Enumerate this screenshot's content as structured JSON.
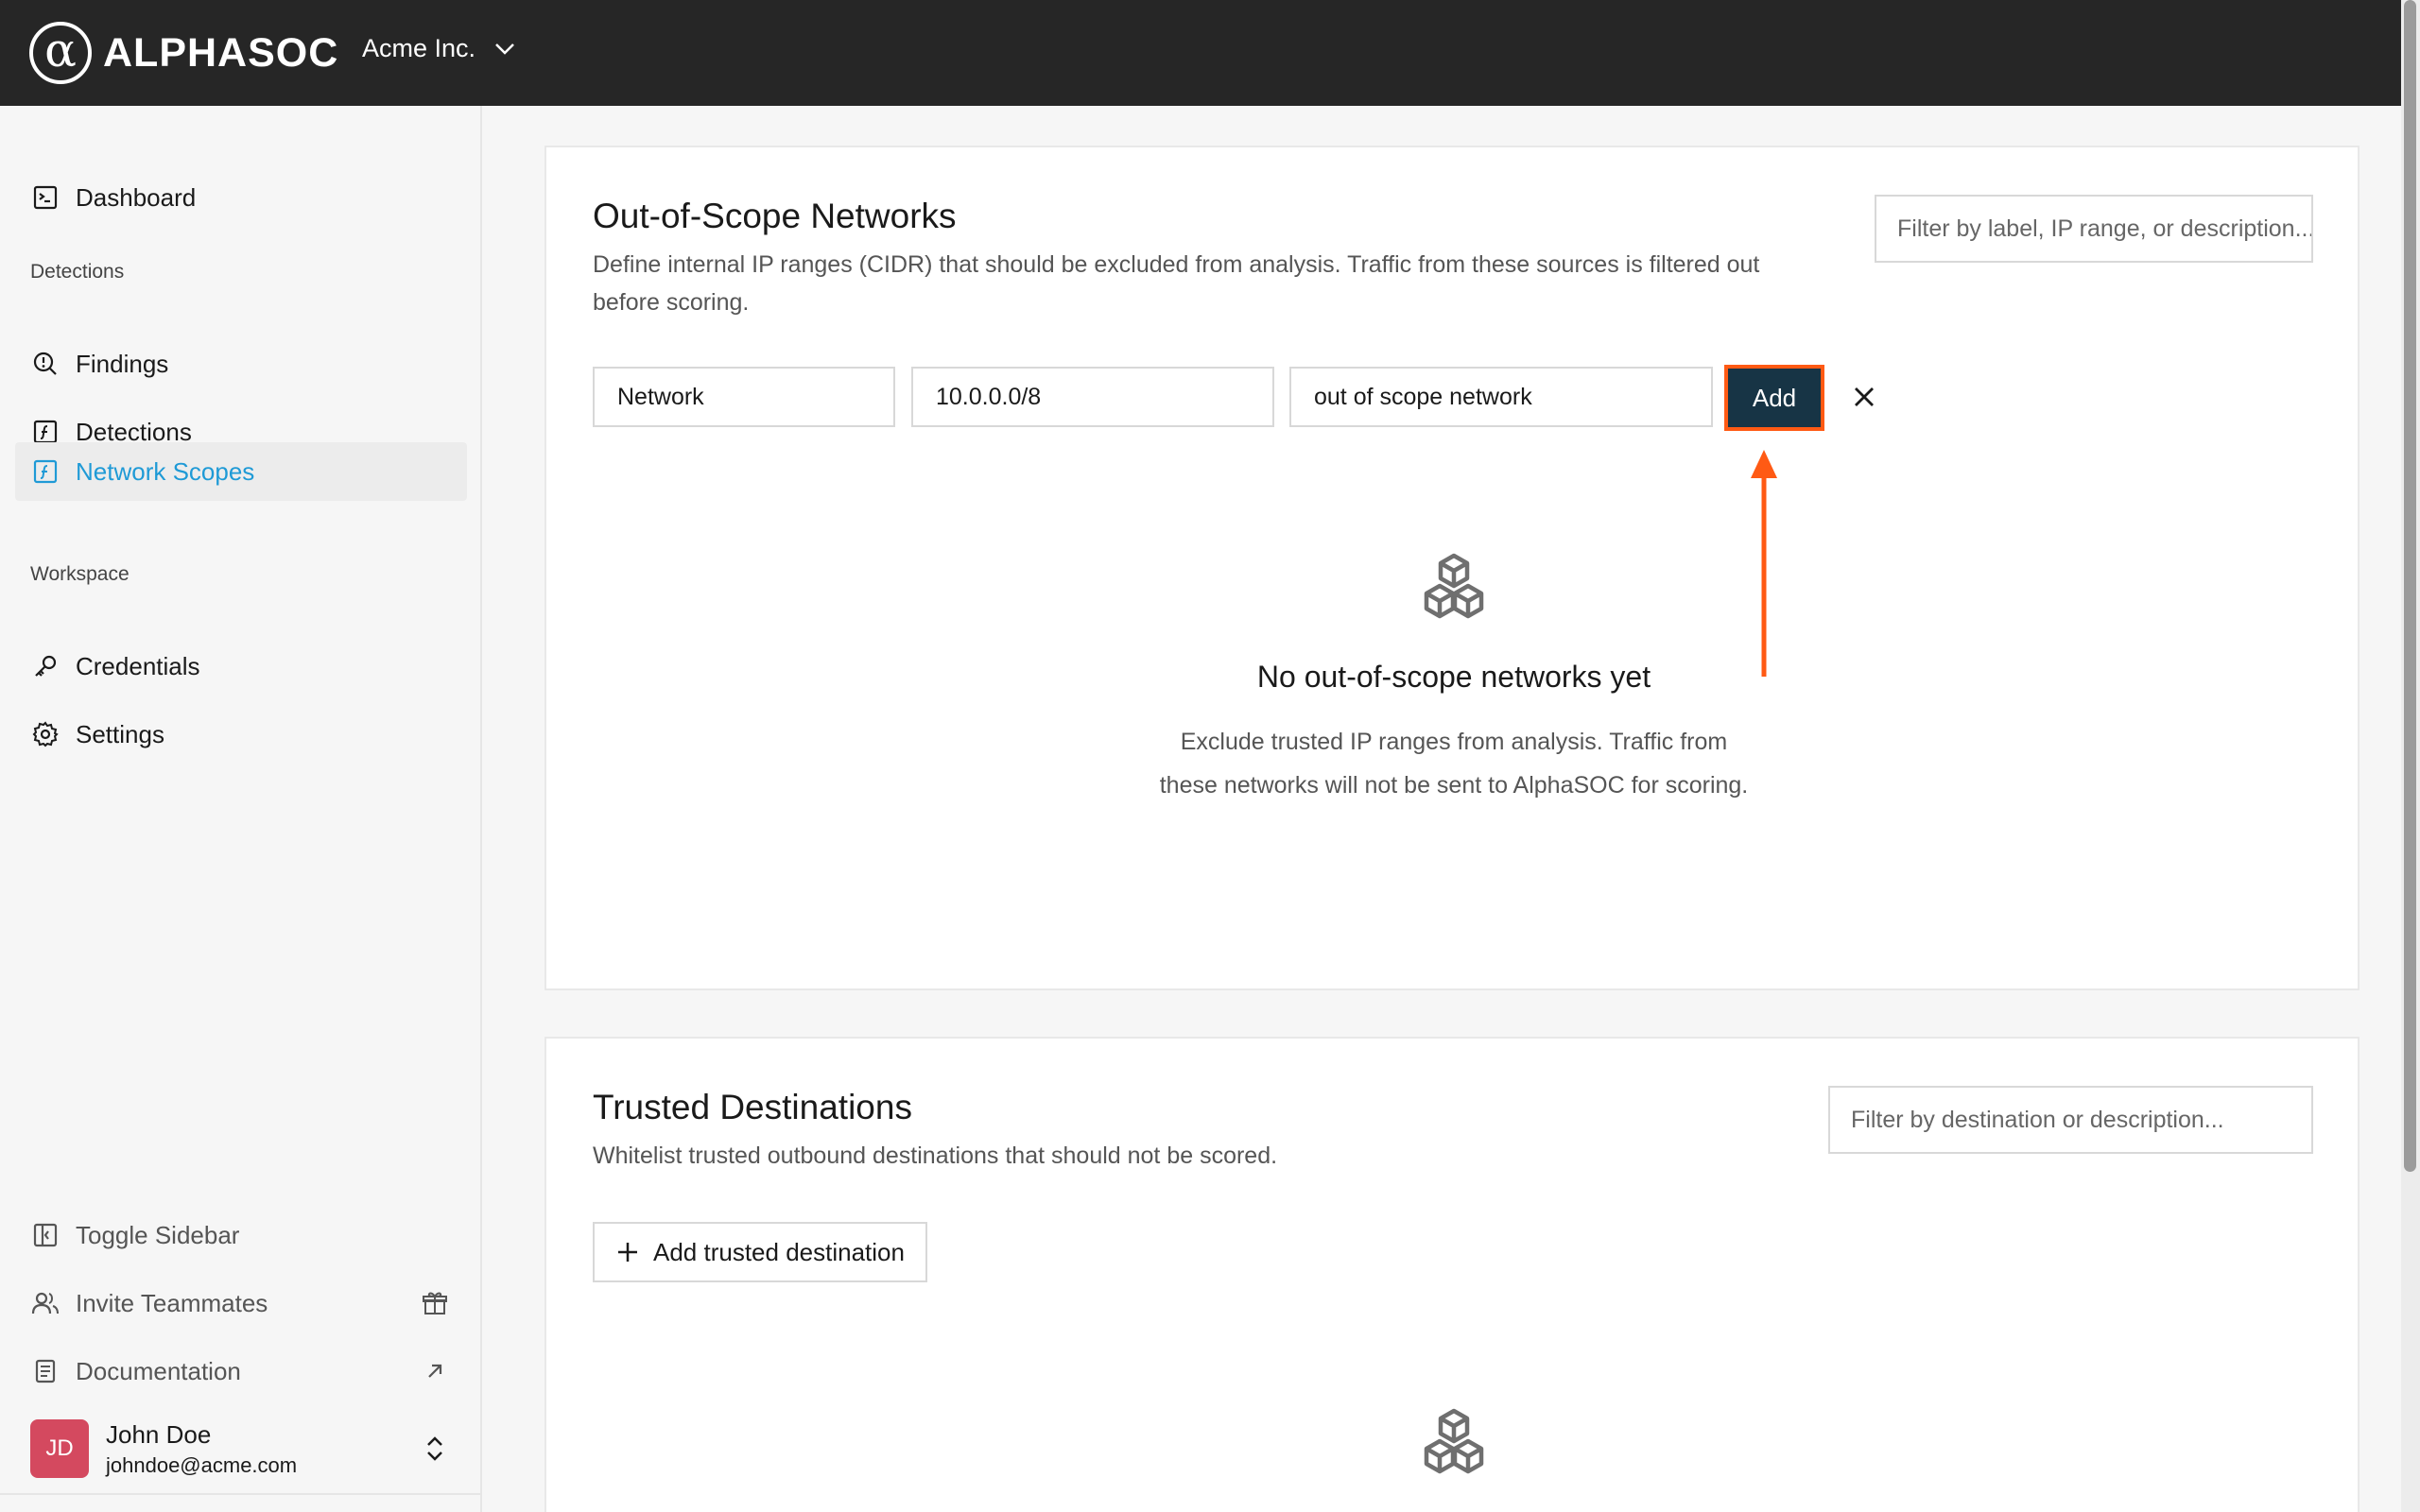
{
  "topbar": {
    "logo_mark": "α",
    "logo_text": "ALPHASOC",
    "org_name": "Acme Inc."
  },
  "sidebar": {
    "dashboard": "Dashboard",
    "section_detections": "Detections",
    "findings": "Findings",
    "detections": "Detections",
    "network_scopes": "Network Scopes",
    "section_workspace": "Workspace",
    "credentials": "Credentials",
    "settings": "Settings",
    "toggle_sidebar": "Toggle Sidebar",
    "invite_teammates": "Invite Teammates",
    "documentation": "Documentation"
  },
  "user": {
    "initials": "JD",
    "name": "John Doe",
    "email": "johndoe@acme.com"
  },
  "out_of_scope": {
    "title": "Out-of-Scope Networks",
    "description_line1": "Define internal IP ranges (CIDR) that should be excluded from analysis. Traffic from these sources is filtered out",
    "description_line2": "before scoring.",
    "filter_placeholder": "Filter by label, IP range, or description...",
    "label_value": "Network",
    "cidr_value": "10.0.0.0/8",
    "description_value": "out of scope network",
    "add_label": "Add",
    "empty_title": "No out-of-scope networks yet",
    "empty_desc_line1": "Exclude trusted IP ranges from analysis. Traffic from",
    "empty_desc_line2": "these networks will not be sent to AlphaSOC for scoring."
  },
  "trusted": {
    "title": "Trusted Destinations",
    "description": "Whitelist trusted outbound destinations that should not be scored.",
    "filter_placeholder": "Filter by destination or description...",
    "add_label": "Add trusted destination"
  },
  "colors": {
    "accent": "#1f9ad6",
    "topbar": "#262626",
    "add_button": "#173445",
    "highlight": "#ff5a14",
    "avatar": "#d4495f"
  },
  "icons": [
    "dashboard-icon",
    "findings-icon",
    "detections-icon",
    "network-scopes-icon",
    "credentials-icon",
    "settings-icon",
    "toggle-sidebar-icon",
    "invite-icon",
    "gift-icon",
    "documentation-icon",
    "external-link-icon",
    "chevron-down-icon",
    "chevron-updown-icon",
    "close-icon",
    "cubes-icon",
    "plus-icon"
  ]
}
